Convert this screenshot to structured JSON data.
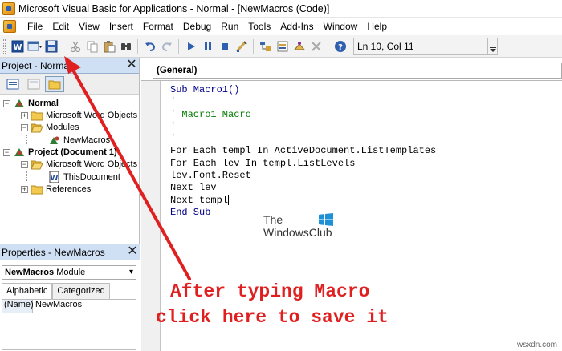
{
  "window": {
    "title": "Microsoft Visual Basic for Applications - Normal - [NewMacros (Code)]"
  },
  "menu": {
    "items": [
      "File",
      "Edit",
      "View",
      "Insert",
      "Format",
      "Debug",
      "Run",
      "Tools",
      "Add-Ins",
      "Window",
      "Help"
    ]
  },
  "toolbar": {
    "buttons": [
      "word-icon",
      "insert-userform-icon",
      "save-icon",
      "cut-icon",
      "copy-icon",
      "paste-icon",
      "find-icon",
      "undo-icon",
      "redo-icon",
      "run-icon",
      "break-icon",
      "reset-icon",
      "design-mode-icon",
      "project-explorer-icon",
      "properties-icon",
      "object-browser-icon",
      "toolbox-icon",
      "help-icon"
    ],
    "status": "Ln 10, Col 11"
  },
  "project_pane": {
    "title": "Project - Normal",
    "tree": [
      {
        "label": "Normal",
        "bold": true,
        "level": 0,
        "icon": "vba-project-icon",
        "expander": "−"
      },
      {
        "label": "Microsoft Word Objects",
        "bold": false,
        "level": 1,
        "icon": "folder-icon",
        "expander": "+"
      },
      {
        "label": "Modules",
        "bold": false,
        "level": 1,
        "icon": "folder-open-icon",
        "expander": "−"
      },
      {
        "label": "NewMacros",
        "bold": false,
        "level": 2,
        "icon": "module-icon",
        "expander": ""
      },
      {
        "label": "Project (Document 1)",
        "bold": true,
        "level": 0,
        "icon": "vba-project-icon",
        "expander": "−"
      },
      {
        "label": "Microsoft Word Objects",
        "bold": false,
        "level": 1,
        "icon": "folder-open-icon",
        "expander": "−"
      },
      {
        "label": "ThisDocument",
        "bold": false,
        "level": 2,
        "icon": "word-doc-icon",
        "expander": ""
      },
      {
        "label": "References",
        "bold": false,
        "level": 1,
        "icon": "folder-icon",
        "expander": "+"
      }
    ]
  },
  "properties_pane": {
    "title": "Properties - NewMacros",
    "object_name": "NewMacros",
    "object_type": "Module",
    "tabs": [
      "Alphabetic",
      "Categorized"
    ],
    "active_tab": 0,
    "rows": [
      {
        "name": "(Name)",
        "value": "NewMacros"
      }
    ]
  },
  "code": {
    "procedure_combo": "(General)",
    "lines": [
      {
        "text": "Sub Macro1()",
        "type": "keyword"
      },
      {
        "text": "'",
        "type": "comment"
      },
      {
        "text": "' Macro1 Macro",
        "type": "comment"
      },
      {
        "text": "'",
        "type": "comment"
      },
      {
        "text": "'",
        "type": "comment"
      },
      {
        "text": "For Each templ In ActiveDocument.ListTemplates",
        "type": "normal"
      },
      {
        "text": "For Each lev In templ.ListLevels",
        "type": "normal"
      },
      {
        "text": "lev.Font.Reset",
        "type": "normal"
      },
      {
        "text": "Next lev",
        "type": "normal"
      },
      {
        "text": "Next templ",
        "type": "normal",
        "caret": true
      },
      {
        "text": "End Sub",
        "type": "keyword"
      }
    ]
  },
  "watermark": {
    "line1": "The",
    "line2": "WindowsClub"
  },
  "annotation": {
    "line1": "After typing Macro",
    "line2": "click here to save it",
    "color": "#e02020"
  },
  "footer": {
    "site": "wsxdn.com"
  }
}
